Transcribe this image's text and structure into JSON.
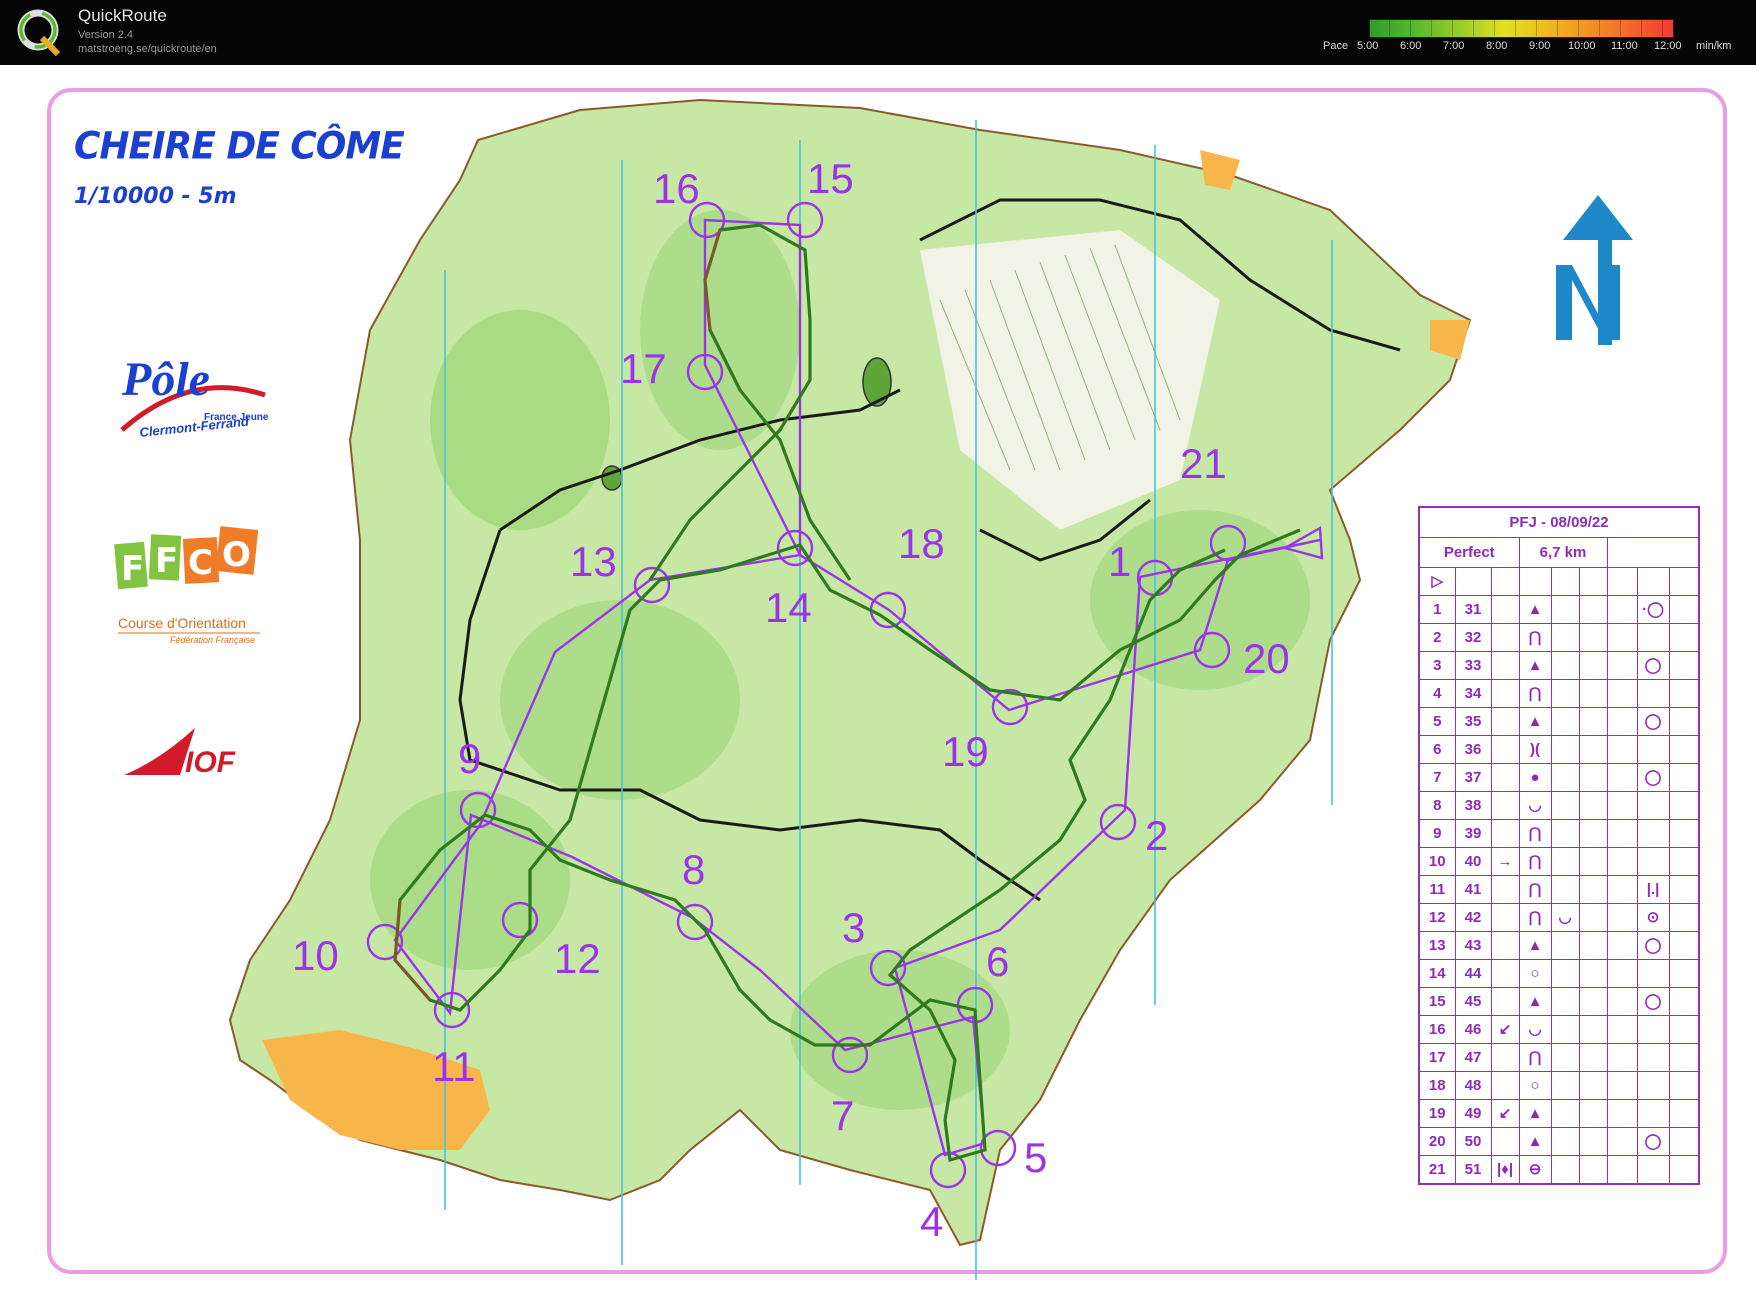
{
  "app": {
    "name": "QuickRoute",
    "version": "Version 2.4",
    "url": "matstroeng.se/quickroute/en",
    "logo_letter": "Q"
  },
  "pace_legend": {
    "label": "Pace",
    "ticks": [
      "5:00",
      "6:00",
      "7:00",
      "8:00",
      "9:00",
      "10:00",
      "11:00",
      "12:00"
    ],
    "unit": "min/km",
    "colors": [
      "#2f9d2a",
      "#9ccc2a",
      "#e4e01e",
      "#f0a81f",
      "#f2742a",
      "#f03a35"
    ]
  },
  "map": {
    "title": "CHEIRE DE CÔME",
    "scale": "1/10000 - 5m",
    "colors": {
      "frame": "#ec9be6",
      "forest": "#c7e8a4",
      "dense": "#8fd06a",
      "open": "#f7b54a",
      "route": "#2f7a1e",
      "course": "#9b34e8",
      "grid": "#46c4d8",
      "title": "#1b3fd1"
    },
    "logos": {
      "pole_text": "Pôle",
      "pole_sub1": "France Jeune",
      "pole_sub2": "Clermont-Ferrand",
      "ffco_letters": [
        "F",
        "F",
        "C",
        "O"
      ],
      "ffco_text1": "Course d'Orientation",
      "ffco_text2": "Fédération Française",
      "iof_text": "IOF",
      "north_icon": "north-arrow"
    },
    "controls": [
      {
        "label": "1"
      },
      {
        "label": "2"
      },
      {
        "label": "3"
      },
      {
        "label": "4"
      },
      {
        "label": "5"
      },
      {
        "label": "6"
      },
      {
        "label": "7"
      },
      {
        "label": "8"
      },
      {
        "label": "9"
      },
      {
        "label": "10"
      },
      {
        "label": "11"
      },
      {
        "label": "12"
      },
      {
        "label": "13"
      },
      {
        "label": "14"
      },
      {
        "label": "15"
      },
      {
        "label": "16"
      },
      {
        "label": "17"
      },
      {
        "label": "18"
      },
      {
        "label": "19"
      },
      {
        "label": "20"
      },
      {
        "label": "21"
      }
    ]
  },
  "description_sheet": {
    "event": "PFJ - 08/09/22",
    "course": "Perfect",
    "length": "6,7 km",
    "start_symbol": "▷",
    "rows": [
      {
        "num": "1",
        "code": "31",
        "d": "",
        "feature": "▲",
        "f2": "",
        "where": "·◯"
      },
      {
        "num": "2",
        "code": "32",
        "d": "",
        "feature": "⋂",
        "f2": "",
        "where": ""
      },
      {
        "num": "3",
        "code": "33",
        "d": "",
        "feature": "▲",
        "f2": "",
        "where": "◯"
      },
      {
        "num": "4",
        "code": "34",
        "d": "",
        "feature": "⋂",
        "f2": "",
        "where": ""
      },
      {
        "num": "5",
        "code": "35",
        "d": "",
        "feature": "▲",
        "f2": "",
        "where": "◯"
      },
      {
        "num": "6",
        "code": "36",
        "d": "",
        "feature": ")(",
        "f2": "",
        "where": ""
      },
      {
        "num": "7",
        "code": "37",
        "d": "",
        "feature": "●",
        "f2": "",
        "where": "◯"
      },
      {
        "num": "8",
        "code": "38",
        "d": "",
        "feature": "◡",
        "f2": "",
        "where": ""
      },
      {
        "num": "9",
        "code": "39",
        "d": "",
        "feature": "⋂",
        "f2": "",
        "where": ""
      },
      {
        "num": "10",
        "code": "40",
        "d": "→",
        "feature": "⋂",
        "f2": "",
        "where": ""
      },
      {
        "num": "11",
        "code": "41",
        "d": "",
        "feature": "⋂",
        "f2": "",
        "where": "|.|"
      },
      {
        "num": "12",
        "code": "42",
        "d": "",
        "feature": "⋂",
        "f2": "◡",
        "where": "⊙"
      },
      {
        "num": "13",
        "code": "43",
        "d": "",
        "feature": "▲",
        "f2": "",
        "where": "◯"
      },
      {
        "num": "14",
        "code": "44",
        "d": "",
        "feature": "○",
        "f2": "",
        "where": ""
      },
      {
        "num": "15",
        "code": "45",
        "d": "",
        "feature": "▲",
        "f2": "",
        "where": "◯"
      },
      {
        "num": "16",
        "code": "46",
        "d": "↙",
        "feature": "◡",
        "f2": "",
        "where": ""
      },
      {
        "num": "17",
        "code": "47",
        "d": "",
        "feature": "⋂",
        "f2": "",
        "where": ""
      },
      {
        "num": "18",
        "code": "48",
        "d": "",
        "feature": "○",
        "f2": "",
        "where": ""
      },
      {
        "num": "19",
        "code": "49",
        "d": "↙",
        "feature": "▲",
        "f2": "",
        "where": ""
      },
      {
        "num": "20",
        "code": "50",
        "d": "",
        "feature": "▲",
        "f2": "",
        "where": "◯"
      },
      {
        "num": "21",
        "code": "51",
        "d": "|♦|",
        "feature": "⊖",
        "f2": "",
        "where": ""
      }
    ]
  }
}
